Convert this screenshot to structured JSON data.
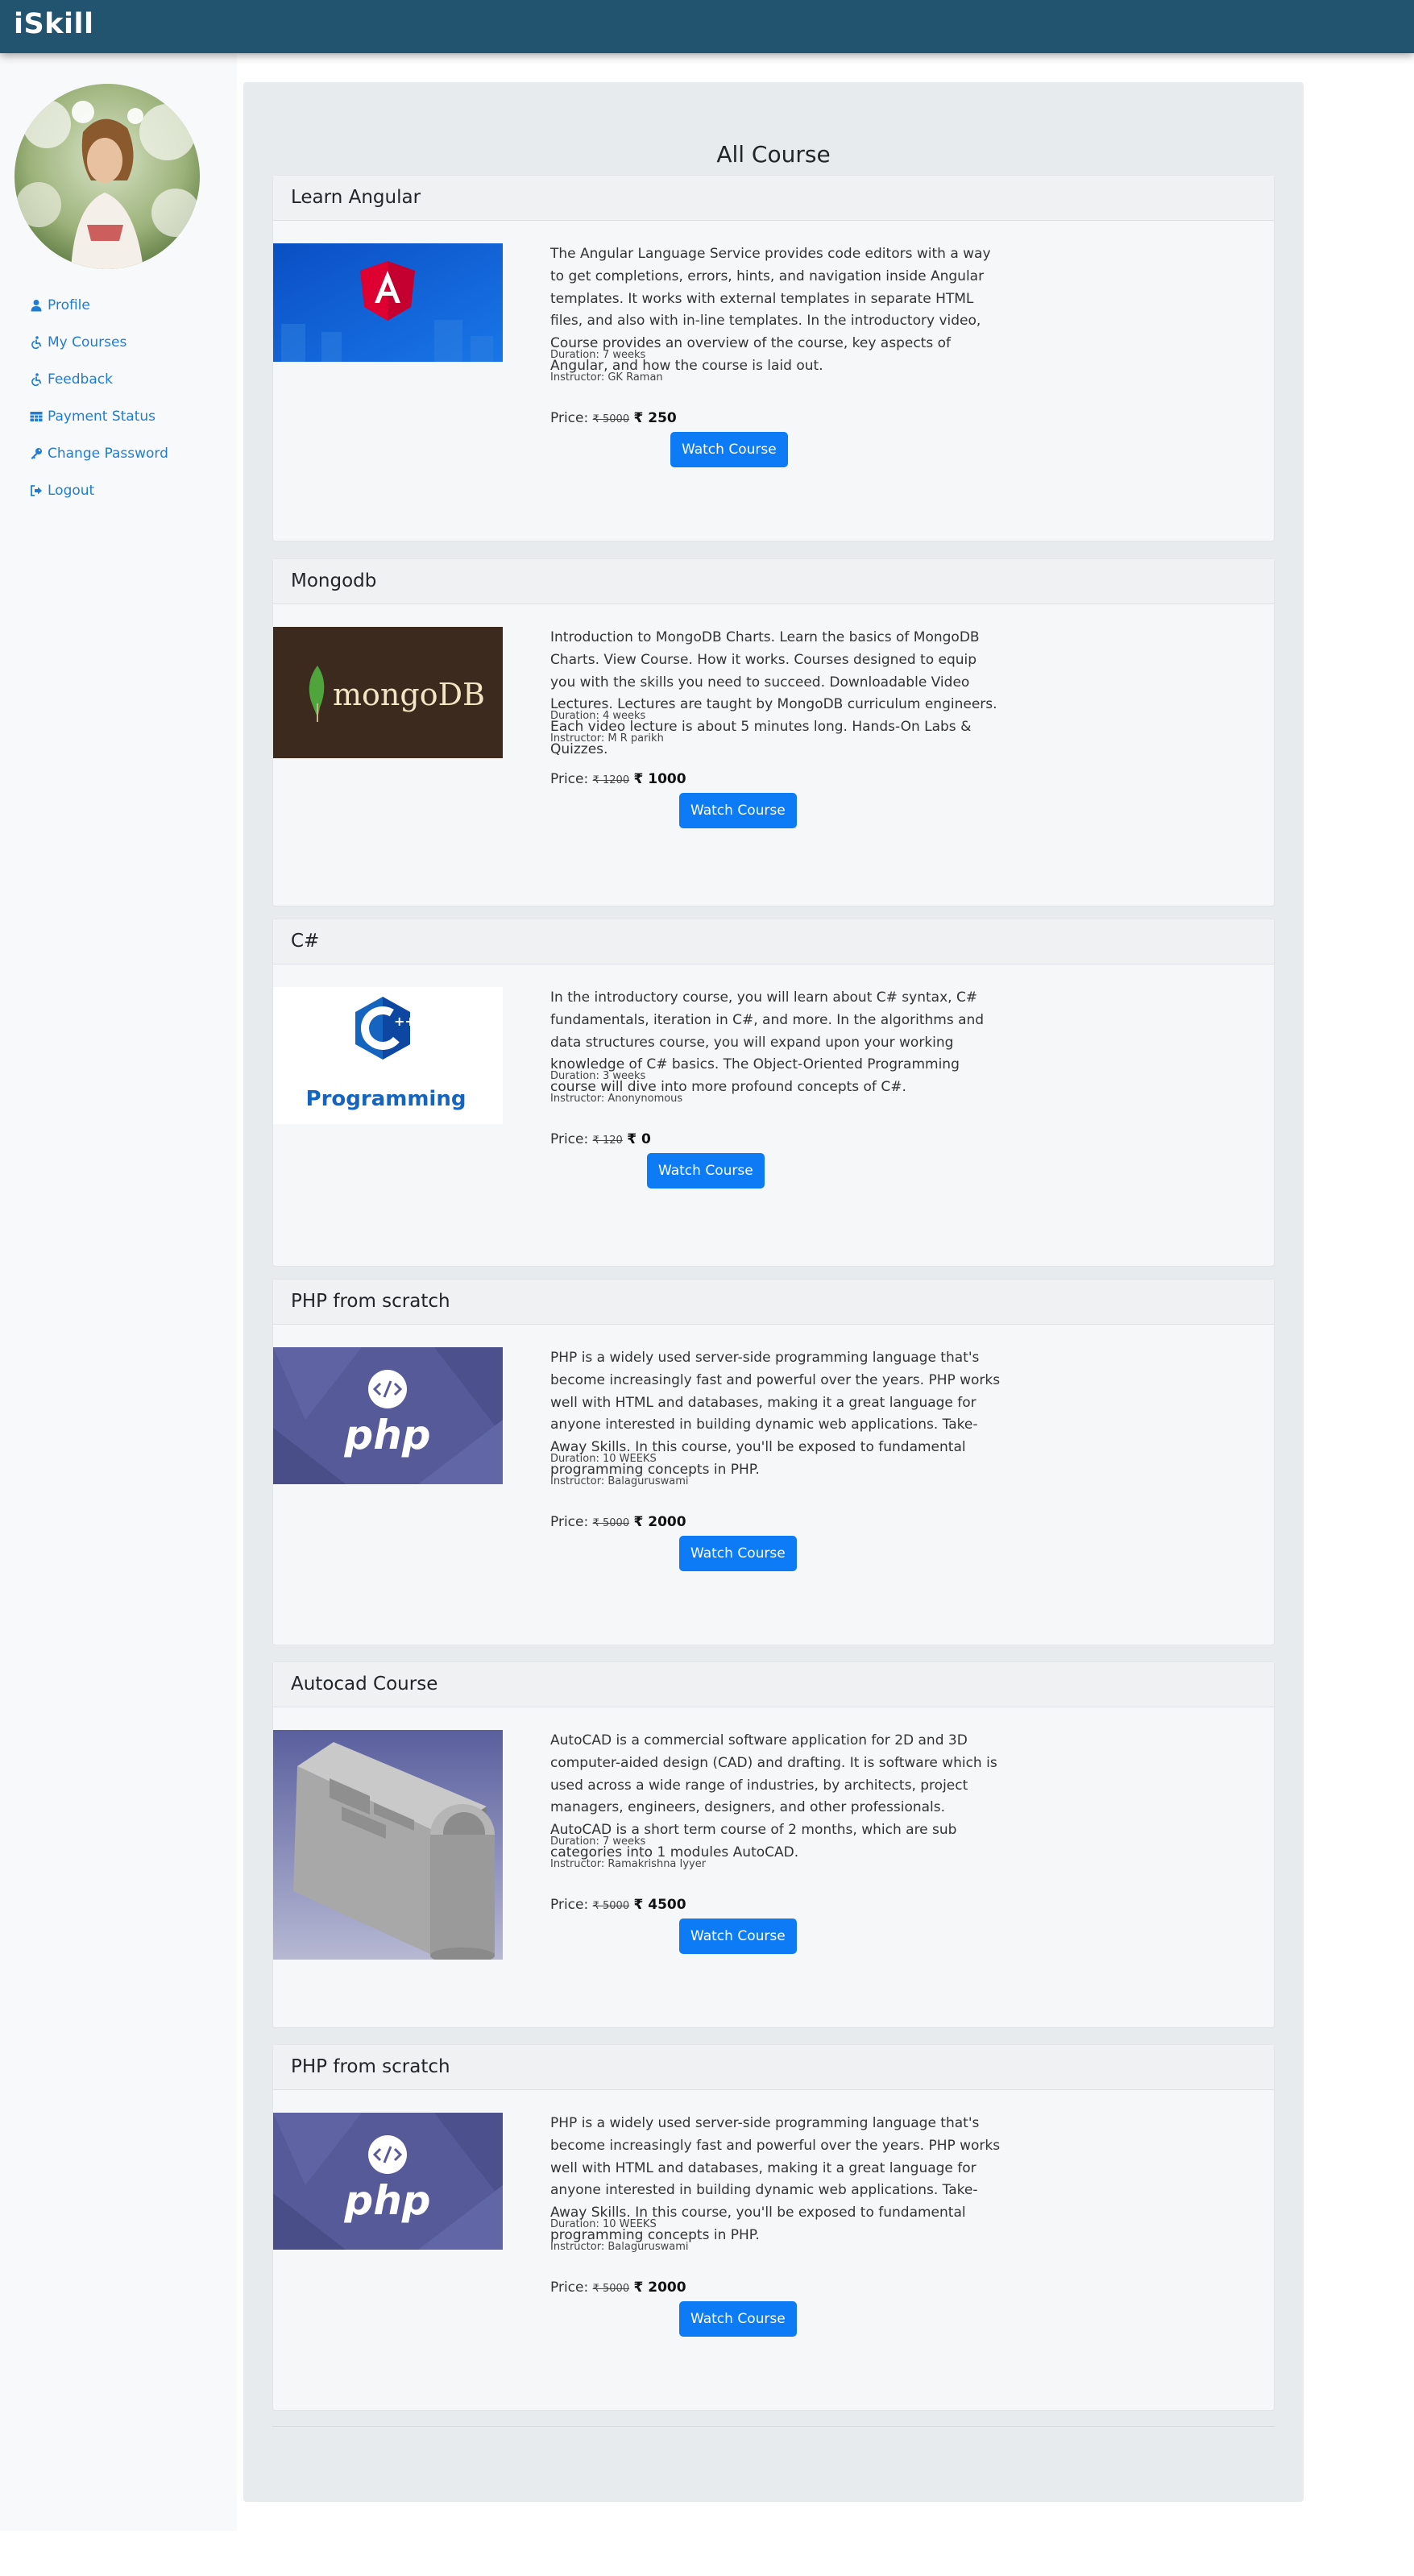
{
  "app": {
    "brand": "iSkill"
  },
  "sidebar": {
    "items": [
      {
        "label": "Profile",
        "icon": "user-icon"
      },
      {
        "label": "My Courses",
        "icon": "accessibility-icon"
      },
      {
        "label": "Feedback",
        "icon": "accessibility-icon"
      },
      {
        "label": "Payment Status",
        "icon": "table-icon"
      },
      {
        "label": "Change Password",
        "icon": "key-icon"
      },
      {
        "label": "Logout",
        "icon": "sign-out-icon"
      }
    ]
  },
  "main": {
    "heading": "All Course",
    "courses": [
      {
        "title": "Learn Angular",
        "description": "The Angular Language Service provides code editors with a way to get completions, errors, hints, and navigation inside Angular templates. It works with external templates in separate HTML files, and also with in-line templates. In the introductory video, Course provides an overview of the course, key aspects of Angular, and how the course is laid out.",
        "duration": "Duration: 7 weeks",
        "instructor": "Instructor: GK Raman",
        "price_label": "Price:",
        "original_price": "₹ 5000",
        "price": "₹ 250",
        "button": "Watch Course",
        "image": "angular-logo"
      },
      {
        "title": "Mongodb",
        "description": "Introduction to MongoDB Charts. Learn the basics of MongoDB Charts. View Course. How it works. Courses designed to equip you with the skills you need to succeed. Downloadable Video Lectures. Lectures are taught by MongoDB curriculum engineers. Each video lecture is about 5 minutes long. Hands-On Labs & Quizzes.",
        "duration": "Duration: 4 weeks",
        "instructor": "Instructor: M R parikh",
        "price_label": "Price:",
        "original_price": "₹ 1200",
        "price": "₹ 1000",
        "button": "Watch Course",
        "image": "mongodb-logo",
        "image_text": "mongoDB"
      },
      {
        "title": "C#",
        "description": "In the introductory course, you will learn about C# syntax, C# fundamentals, iteration in C#, and more. In the algorithms and data structures course, you will expand upon your working knowledge of C# basics. The Object-Oriented Programming course will dive into more profound concepts of C#.",
        "duration": "Duration: 3 weeks",
        "instructor": "Instructor: Anonynomous",
        "price_label": "Price:",
        "original_price": "₹ 120",
        "price": "₹ 0",
        "button": "Watch Course",
        "image": "cpp-programming-logo",
        "image_text": "Programming"
      },
      {
        "title": "PHP from scratch",
        "description": "PHP is a widely used server-side programming language that's become increasingly fast and powerful over the years. PHP works well with HTML and databases, making it a great language for anyone interested in building dynamic web applications. Take-Away Skills. In this course, you'll be exposed to fundamental programming concepts in PHP.",
        "duration": "Duration: 10 WEEKS",
        "instructor": "Instructor: Balaguruswami",
        "price_label": "Price:",
        "original_price": "₹ 5000",
        "price": "₹ 2000",
        "button": "Watch Course",
        "image": "php-logo",
        "image_text": "php"
      },
      {
        "title": "Autocad Course",
        "description": "AutoCAD is a commercial software application for 2D and 3D computer-aided design (CAD) and drafting. It is software which is used across a wide range of industries, by architects, project managers, engineers, designers, and other professionals. AutoCAD is a short term course of 2 months, which are sub categories into 1 modules AutoCAD.",
        "duration": "Duration: 7 weeks",
        "instructor": "Instructor: Ramakrishna Iyyer",
        "price_label": "Price:",
        "original_price": "₹ 5000",
        "price": "₹ 4500",
        "button": "Watch Course",
        "image": "autocad-model"
      },
      {
        "title": "PHP from scratch",
        "description": "PHP is a widely used server-side programming language that's become increasingly fast and powerful over the years. PHP works well with HTML and databases, making it a great language for anyone interested in building dynamic web applications. Take-Away Skills. In this course, you'll be exposed to fundamental programming concepts in PHP.",
        "duration": "Duration: 10 WEEKS",
        "instructor": "Instructor: Balaguruswami",
        "price_label": "Price:",
        "original_price": "₹ 5000",
        "price": "₹ 2000",
        "button": "Watch Course",
        "image": "php-logo",
        "image_text": "php"
      }
    ]
  },
  "colors": {
    "topbar": "#225470",
    "link": "#1e7dd3",
    "button": "#0d7bf5",
    "panel": "#e8ebee"
  }
}
